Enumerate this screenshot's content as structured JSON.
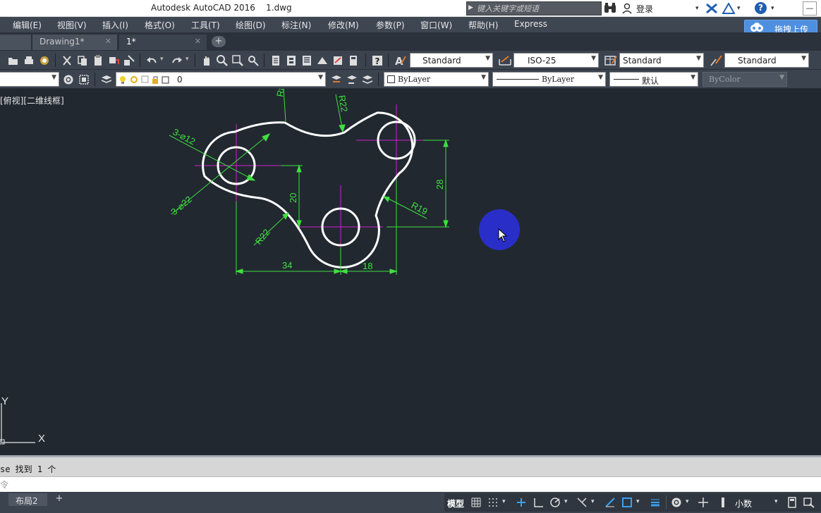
{
  "titlebar": {
    "title": "Autodesk AutoCAD 2016    1.dwg",
    "search_placeholder": "键入关键字或短语",
    "login_label": "登录"
  },
  "menu": {
    "items": [
      {
        "label": "编辑(E)"
      },
      {
        "label": "视图(V)"
      },
      {
        "label": "插入(I)"
      },
      {
        "label": "格式(O)"
      },
      {
        "label": "工具(T)"
      },
      {
        "label": "绘图(D)"
      },
      {
        "label": "标注(N)"
      },
      {
        "label": "修改(M)"
      },
      {
        "label": "参数(P)"
      },
      {
        "label": "窗口(W)"
      },
      {
        "label": "帮助(H)"
      },
      {
        "label": "Express"
      }
    ],
    "upload_label": "拖拽上传"
  },
  "tabs": {
    "items": [
      {
        "label": "Drawing1*",
        "active": false
      },
      {
        "label": "1*",
        "active": true
      }
    ]
  },
  "toolbar": {
    "text_style": "Standard",
    "dim_style": "ISO-25",
    "table_style": "Standard",
    "mleader_style": "Standard",
    "layer": "0",
    "color": "ByLayer",
    "linetype": "ByLayer",
    "lineweight": "默认",
    "plotstyle": "ByColor"
  },
  "viewport": {
    "label": "[俯视][二维线框]",
    "axis_x": "X",
    "axis_y": "Y"
  },
  "dimensions": {
    "dia_small": "3-⌀12",
    "dia_large": "3-⌀22",
    "r_top_left": "R8",
    "r_top": "R22",
    "r_right": "R19",
    "r_bottom_left": "R22",
    "v_left": "20",
    "v_right": "28",
    "h_left": "34",
    "h_right": "18"
  },
  "command": {
    "history": "se 找到 1 个",
    "input_placeholder": "令"
  },
  "statusbar": {
    "layout_tab": "布局2",
    "model": "模型",
    "units": "小数"
  },
  "colors": {
    "canvas": "#212830",
    "dimension": "#3fe03f",
    "centerline": "#d020d0",
    "geometry": "#ffffff",
    "cursor_highlight": "#2a2ec8"
  }
}
